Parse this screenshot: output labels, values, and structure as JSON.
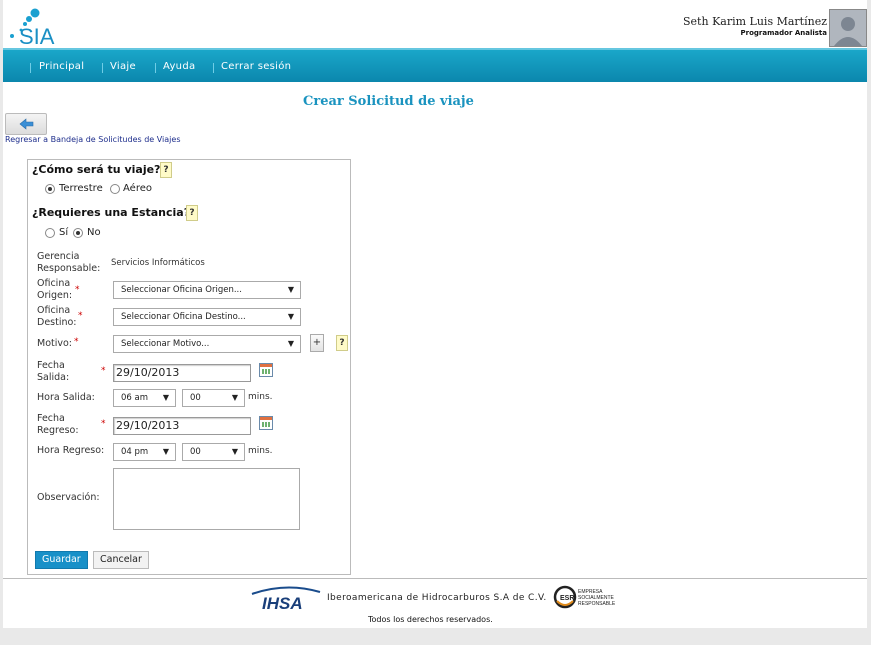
{
  "header": {
    "logo_text": "SIA",
    "user_name": "Seth Karim Luis Martínez",
    "user_role": "Programador Analista"
  },
  "nav": {
    "items": [
      "Principal",
      "Viaje",
      "Ayuda",
      "Cerrar sesión"
    ]
  },
  "page": {
    "title": "Crear Solicitud de viaje",
    "back_link": "Regresar a Bandeja de Solicitudes de Viajes"
  },
  "form": {
    "q_trip": "¿Cómo será tu viaje?:",
    "trip_options": [
      "Terrestre",
      "Aéreo"
    ],
    "trip_selected": "Terrestre",
    "q_stay": "¿Requieres una Estancia?:",
    "stay_options": [
      "Sí",
      "No"
    ],
    "stay_selected": "No",
    "help": "?",
    "required_mark": "*",
    "gerencia_label_1": "Gerencia",
    "gerencia_label_2": "Responsable:",
    "gerencia_value": "Servicios Informáticos",
    "origen_label_1": "Oficina",
    "origen_label_2": "Origen:",
    "origen_value": "Seleccionar Oficina Origen...",
    "destino_label_1": "Oficina",
    "destino_label_2": "Destino:",
    "destino_value": "Seleccionar Oficina Destino...",
    "motivo_label": "Motivo:",
    "motivo_value": "Seleccionar Motivo...",
    "add_label": "+",
    "salida_label_1": "Fecha",
    "salida_label_2": "Salida:",
    "salida_value": "29/10/2013",
    "hora_salida_label": "Hora Salida:",
    "hora_salida_hour": "06 am",
    "hora_salida_min": "00",
    "mins": "mins.",
    "regreso_label_1": "Fecha",
    "regreso_label_2": "Regreso:",
    "regreso_value": "29/10/2013",
    "hora_regreso_label": "Hora Regreso:",
    "hora_regreso_hour": "04 pm",
    "hora_regreso_min": "00",
    "observacion_label": "Observación:",
    "observacion_value": "",
    "save_label": "Guardar",
    "cancel_label": "Cancelar"
  },
  "footer": {
    "ihsa_logo": "IHSA",
    "company": "Iberoamericana de Hidrocarburos S.A de C.V.",
    "esr_logo_lines": [
      "EMPRESA",
      "SOCIALMENTE",
      "RESPONSABLE"
    ],
    "rights": "Todos los derechos reservados."
  },
  "colors": {
    "nav_bg": "#0b87ad",
    "title": "#1a93bf",
    "primary_button": "#1890c8",
    "required": "#cc0000",
    "help_bg": "#fffbc8"
  }
}
